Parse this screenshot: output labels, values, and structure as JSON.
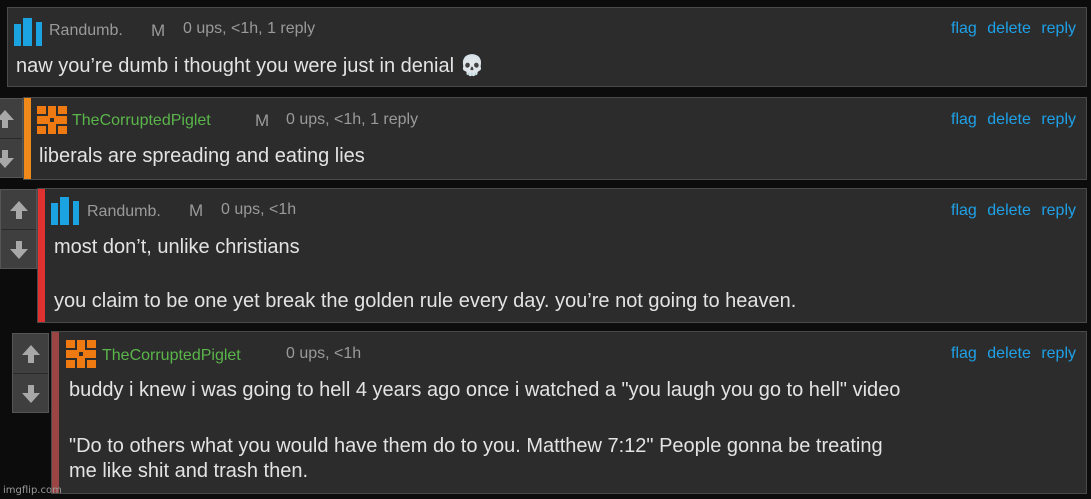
{
  "colors": {
    "accent_orange": "#ef8a1a",
    "accent_red": "#e03131",
    "accent_maroon": "#9b4444",
    "link": "#1ea1e8",
    "username_green": "#5ab54a"
  },
  "actions": {
    "flag": "flag",
    "delete": "delete",
    "reply": "reply"
  },
  "comments": [
    {
      "username": "Randumb.",
      "mod_badge": "M",
      "meta": "0 ups, <1h, 1 reply",
      "text": "naw you’re dumb i thought you were just in denial 💀",
      "avatar_icon": "blue-bars-avatar-icon"
    },
    {
      "username": "TheCorruptedPiglet",
      "mod_badge": "M",
      "meta": "0 ups, <1h, 1 reply",
      "text": "liberals are spreading and eating lies",
      "avatar_icon": "orange-cross-avatar-icon"
    },
    {
      "username": "Randumb.",
      "mod_badge": "M",
      "meta": "0 ups, <1h",
      "text_line1": "most don’t, unlike christians",
      "text_line2": "you claim to be one yet break the golden rule every day. you’re not going to heaven.",
      "avatar_icon": "blue-bars-avatar-icon"
    },
    {
      "username": "TheCorruptedPiglet",
      "meta": "0 ups, <1h",
      "text_line1": "buddy i knew i was going to hell 4 years ago once i watched a \"you laugh you go to hell\" video",
      "text_line2": "\"Do to others what you would have them do to you. Matthew 7:12\" People gonna be treating",
      "text_line3": "me like shit and trash then.",
      "avatar_icon": "orange-cross-avatar-icon"
    }
  ],
  "watermark": "imgflip.com"
}
